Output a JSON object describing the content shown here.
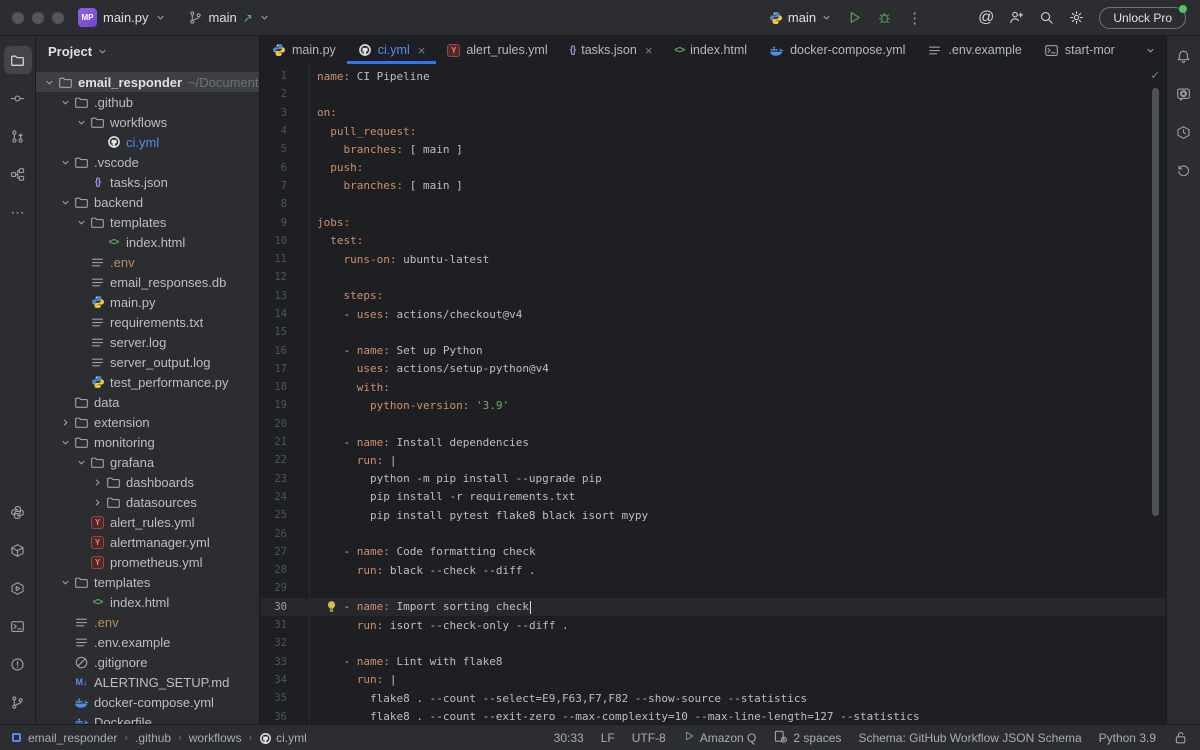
{
  "title_bar": {
    "file_badge": "MP",
    "file_menu": "main.py",
    "branch_name": "main",
    "run_config": "main",
    "unlock_label": "Unlock Pro"
  },
  "tab_bar": {
    "tabs": [
      {
        "label": "main.py",
        "icon": "python",
        "active": false,
        "closable": false
      },
      {
        "label": "ci.yml",
        "icon": "github",
        "active": true,
        "closable": true
      },
      {
        "label": "alert_rules.yml",
        "icon": "yaml",
        "active": false,
        "closable": false
      },
      {
        "label": "tasks.json",
        "icon": "json",
        "active": false,
        "closable": true
      },
      {
        "label": "index.html",
        "icon": "html",
        "active": false,
        "closable": false
      },
      {
        "label": "docker-compose.yml",
        "icon": "docker",
        "active": false,
        "closable": false
      },
      {
        "label": ".env.example",
        "icon": "textfile",
        "active": false,
        "closable": false
      },
      {
        "label": "start-mor",
        "icon": "terminal",
        "active": false,
        "closable": false
      }
    ]
  },
  "project_panel": {
    "header": "Project",
    "tree": [
      {
        "label": "email_responder",
        "suffix": "~/Documents/Pro",
        "level": 0,
        "chevron": "open",
        "icon": "folder",
        "bold": true,
        "selected": true
      },
      {
        "label": ".github",
        "level": 1,
        "chevron": "open",
        "icon": "folder"
      },
      {
        "label": "workflows",
        "level": 2,
        "chevron": "open",
        "icon": "folder"
      },
      {
        "label": "ci.yml",
        "level": 3,
        "chevron": "none",
        "icon": "github",
        "color": "blue"
      },
      {
        "label": ".vscode",
        "level": 1,
        "chevron": "open",
        "icon": "folder"
      },
      {
        "label": "tasks.json",
        "level": 2,
        "chevron": "none",
        "icon": "json"
      },
      {
        "label": "backend",
        "level": 1,
        "chevron": "open",
        "icon": "folder"
      },
      {
        "label": "templates",
        "level": 2,
        "chevron": "open",
        "icon": "folder"
      },
      {
        "label": "index.html",
        "level": 3,
        "chevron": "none",
        "icon": "html"
      },
      {
        "label": ".env",
        "level": 2,
        "chevron": "none",
        "icon": "textfile",
        "color": "orange"
      },
      {
        "label": "email_responses.db",
        "level": 2,
        "chevron": "none",
        "icon": "textfile"
      },
      {
        "label": "main.py",
        "level": 2,
        "chevron": "none",
        "icon": "python"
      },
      {
        "label": "requirements.txt",
        "level": 2,
        "chevron": "none",
        "icon": "textfile"
      },
      {
        "label": "server.log",
        "level": 2,
        "chevron": "none",
        "icon": "textfile"
      },
      {
        "label": "server_output.log",
        "level": 2,
        "chevron": "none",
        "icon": "textfile"
      },
      {
        "label": "test_performance.py",
        "level": 2,
        "chevron": "none",
        "icon": "python"
      },
      {
        "label": "data",
        "level": 1,
        "chevron": "none",
        "icon": "folder"
      },
      {
        "label": "extension",
        "level": 1,
        "chevron": "closed",
        "icon": "folder"
      },
      {
        "label": "monitoring",
        "level": 1,
        "chevron": "open",
        "icon": "folder"
      },
      {
        "label": "grafana",
        "level": 2,
        "chevron": "open",
        "icon": "folder"
      },
      {
        "label": "dashboards",
        "level": 3,
        "chevron": "closed",
        "icon": "folder"
      },
      {
        "label": "datasources",
        "level": 3,
        "chevron": "closed",
        "icon": "folder"
      },
      {
        "label": "alert_rules.yml",
        "level": 2,
        "chevron": "none",
        "icon": "yaml"
      },
      {
        "label": "alertmanager.yml",
        "level": 2,
        "chevron": "none",
        "icon": "yaml"
      },
      {
        "label": "prometheus.yml",
        "level": 2,
        "chevron": "none",
        "icon": "yaml"
      },
      {
        "label": "templates",
        "level": 1,
        "chevron": "open",
        "icon": "folder"
      },
      {
        "label": "index.html",
        "level": 2,
        "chevron": "none",
        "icon": "html"
      },
      {
        "label": ".env",
        "level": 1,
        "chevron": "none",
        "icon": "textfile",
        "color": "orange"
      },
      {
        "label": ".env.example",
        "level": 1,
        "chevron": "none",
        "icon": "textfile"
      },
      {
        "label": ".gitignore",
        "level": 1,
        "chevron": "none",
        "icon": "ignore"
      },
      {
        "label": "ALERTING_SETUP.md",
        "level": 1,
        "chevron": "none",
        "icon": "markdown"
      },
      {
        "label": "docker-compose.yml",
        "level": 1,
        "chevron": "none",
        "icon": "docker"
      },
      {
        "label": "Dockerfile",
        "level": 1,
        "chevron": "none",
        "icon": "docker"
      }
    ]
  },
  "editor": {
    "current_line": 30,
    "lines": [
      {
        "n": 1,
        "seg": [
          [
            "k",
            "name:"
          ],
          [
            "v",
            " CI Pipeline"
          ]
        ]
      },
      {
        "n": 2,
        "seg": []
      },
      {
        "n": 3,
        "seg": [
          [
            "k",
            "on:"
          ]
        ]
      },
      {
        "n": 4,
        "seg": [
          [
            "v",
            "  "
          ],
          [
            "k",
            "pull_request:"
          ]
        ]
      },
      {
        "n": 5,
        "seg": [
          [
            "v",
            "    "
          ],
          [
            "k",
            "branches:"
          ],
          [
            "v",
            " [ main ]"
          ]
        ]
      },
      {
        "n": 6,
        "seg": [
          [
            "v",
            "  "
          ],
          [
            "k",
            "push:"
          ]
        ]
      },
      {
        "n": 7,
        "seg": [
          [
            "v",
            "    "
          ],
          [
            "k",
            "branches:"
          ],
          [
            "v",
            " [ main ]"
          ]
        ]
      },
      {
        "n": 8,
        "seg": []
      },
      {
        "n": 9,
        "seg": [
          [
            "k",
            "jobs:"
          ]
        ]
      },
      {
        "n": 10,
        "seg": [
          [
            "v",
            "  "
          ],
          [
            "k",
            "test:"
          ]
        ]
      },
      {
        "n": 11,
        "seg": [
          [
            "v",
            "    "
          ],
          [
            "k",
            "runs-on:"
          ],
          [
            "v",
            " ubuntu-latest"
          ]
        ]
      },
      {
        "n": 12,
        "seg": []
      },
      {
        "n": 13,
        "seg": [
          [
            "v",
            "    "
          ],
          [
            "k",
            "steps:"
          ]
        ]
      },
      {
        "n": 14,
        "seg": [
          [
            "v",
            "    - "
          ],
          [
            "k",
            "uses:"
          ],
          [
            "v",
            " actions/checkout@v4"
          ]
        ]
      },
      {
        "n": 15,
        "seg": []
      },
      {
        "n": 16,
        "seg": [
          [
            "v",
            "    - "
          ],
          [
            "k",
            "name:"
          ],
          [
            "v",
            " Set up Python"
          ]
        ]
      },
      {
        "n": 17,
        "seg": [
          [
            "v",
            "      "
          ],
          [
            "k",
            "uses:"
          ],
          [
            "v",
            " actions/setup-python@v4"
          ]
        ]
      },
      {
        "n": 18,
        "seg": [
          [
            "v",
            "      "
          ],
          [
            "k",
            "with:"
          ]
        ]
      },
      {
        "n": 19,
        "seg": [
          [
            "v",
            "        "
          ],
          [
            "k",
            "python-version:"
          ],
          [
            "s",
            " '3.9'"
          ]
        ]
      },
      {
        "n": 20,
        "seg": []
      },
      {
        "n": 21,
        "seg": [
          [
            "v",
            "    - "
          ],
          [
            "k",
            "name:"
          ],
          [
            "v",
            " Install dependencies"
          ]
        ]
      },
      {
        "n": 22,
        "seg": [
          [
            "v",
            "      "
          ],
          [
            "k",
            "run:"
          ],
          [
            "v",
            " |"
          ]
        ]
      },
      {
        "n": 23,
        "seg": [
          [
            "v",
            "        python -m pip install --upgrade pip"
          ]
        ]
      },
      {
        "n": 24,
        "seg": [
          [
            "v",
            "        pip install -r requirements.txt"
          ]
        ]
      },
      {
        "n": 25,
        "seg": [
          [
            "v",
            "        pip install pytest flake8 black isort mypy"
          ]
        ]
      },
      {
        "n": 26,
        "seg": []
      },
      {
        "n": 27,
        "seg": [
          [
            "v",
            "    - "
          ],
          [
            "k",
            "name:"
          ],
          [
            "v",
            " Code formatting check"
          ]
        ]
      },
      {
        "n": 28,
        "seg": [
          [
            "v",
            "      "
          ],
          [
            "k",
            "run:"
          ],
          [
            "v",
            " black --check --diff ."
          ]
        ]
      },
      {
        "n": 29,
        "seg": []
      },
      {
        "n": 30,
        "seg": [
          [
            "v",
            "    - "
          ],
          [
            "k",
            "name:"
          ],
          [
            "v",
            " Import sorting check"
          ]
        ]
      },
      {
        "n": 31,
        "seg": [
          [
            "v",
            "      "
          ],
          [
            "k",
            "run:"
          ],
          [
            "v",
            " isort --check-only --diff ."
          ]
        ]
      },
      {
        "n": 32,
        "seg": []
      },
      {
        "n": 33,
        "seg": [
          [
            "v",
            "    - "
          ],
          [
            "k",
            "name:"
          ],
          [
            "v",
            " Lint with flake8"
          ]
        ]
      },
      {
        "n": 34,
        "seg": [
          [
            "v",
            "      "
          ],
          [
            "k",
            "run:"
          ],
          [
            "v",
            " |"
          ]
        ]
      },
      {
        "n": 35,
        "seg": [
          [
            "v",
            "        flake8 . --count --select=E9,F63,F7,F82 --show-source --statistics"
          ]
        ]
      },
      {
        "n": 36,
        "seg": [
          [
            "v",
            "        flake8 . --count --exit-zero --max-complexity=10 --max-line-length=127 --statistics"
          ]
        ]
      }
    ]
  },
  "status_bar": {
    "breadcrumbs": [
      "email_responder",
      ".github",
      "workflows",
      "ci.yml"
    ],
    "position": "30:33",
    "line_separator": "LF",
    "encoding": "UTF-8",
    "assistant": "Amazon Q",
    "indent": "2 spaces",
    "schema": "Schema: GitHub Workflow JSON Schema",
    "interpreter": "Python 3.9"
  },
  "colors": {
    "accent_blue": "#3574f0",
    "selected_file_blue": "#548af7",
    "yaml_key_orange": "#cf8e6d",
    "string_green": "#6aab73",
    "run_green": "#57965c",
    "panel_gray": "#2b2d30"
  }
}
